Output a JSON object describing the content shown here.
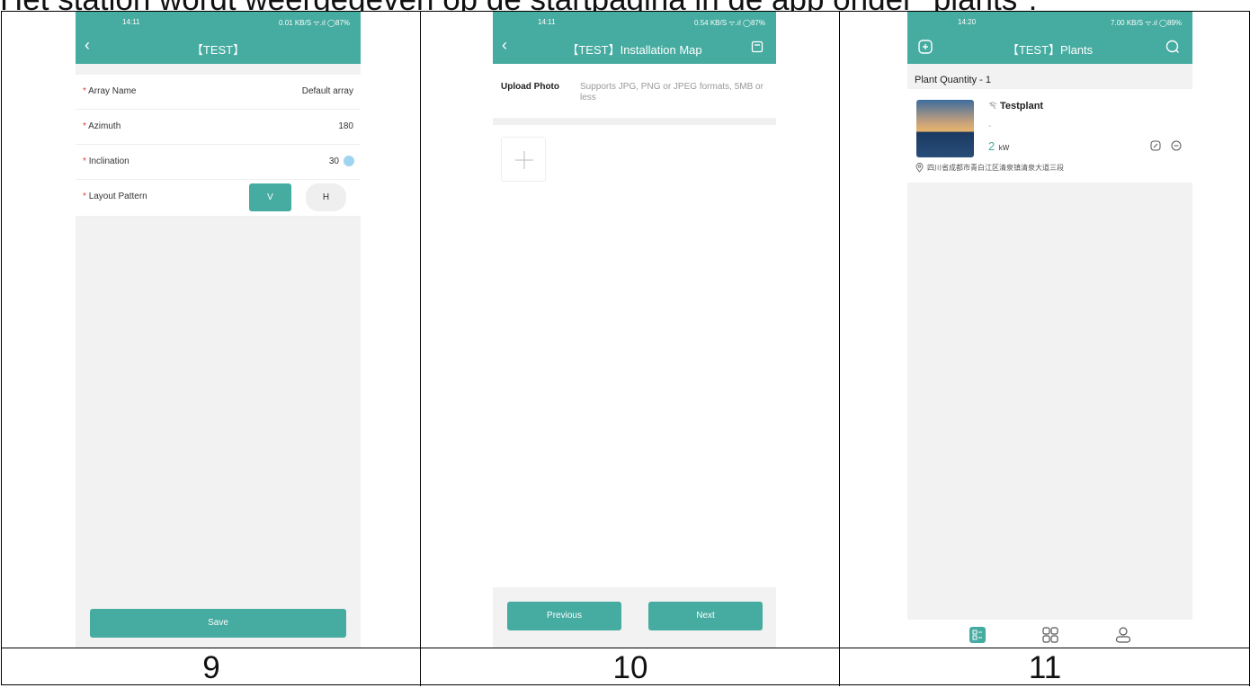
{
  "caption": "Het station wordt weergegeven op de startpagina in de app onder \"plants\".",
  "screens": [
    {
      "status_time": "14:11",
      "status_right": "0.01 KB/S ᯤ.ıl ◯87%",
      "title": "【TEST】",
      "rows": [
        {
          "label": "Array Name",
          "value": "Default array"
        },
        {
          "label": "Azimuth",
          "value": "180"
        },
        {
          "label": "Inclination",
          "value": "30"
        },
        {
          "label": "Layout Pattern",
          "value": ""
        }
      ],
      "layout_options": [
        "V",
        "H"
      ],
      "save_label": "Save"
    },
    {
      "status_time": "14:11",
      "status_right": "0.54 KB/S ᯤ.ıl ◯87%",
      "title": "【TEST】Installation Map",
      "upload_label": "Upload Photo",
      "upload_hint": "Supports JPG, PNG or JPEG formats, 5MB or less",
      "previous_label": "Previous",
      "next_label": "Next"
    },
    {
      "status_time": "14:20",
      "status_right": "7.00 KB/S ᯤ.ıl ◯89%",
      "title": "【TEST】Plants",
      "quantity_label": "Plant Quantity - 1",
      "plant_name": "Testplant",
      "plant_sub": "-",
      "plant_power": "2",
      "plant_unit": "kW",
      "plant_address": "四川省成都市青白江区清泉镇清泉大道三段"
    }
  ],
  "step_numbers": [
    "9",
    "10",
    "11"
  ],
  "colors": {
    "accent": "#46aba0",
    "required": "#e53935"
  }
}
